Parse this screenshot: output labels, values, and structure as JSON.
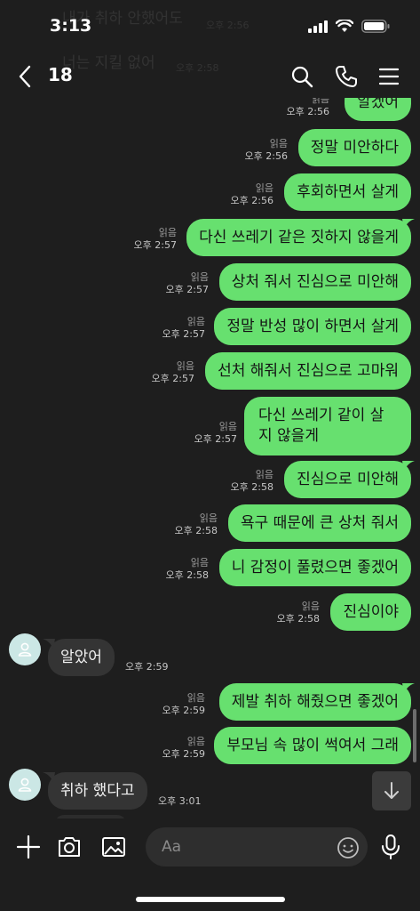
{
  "status_bar": {
    "time": "3:13"
  },
  "background_ghost": {
    "line1": "내가 취하 안했어도",
    "line1_time": "오후 2:56",
    "line2": "너는 지킬 없어",
    "line2_time": "오후 2:58"
  },
  "header": {
    "title": "18"
  },
  "labels": {
    "read": "읽음"
  },
  "messages": [
    {
      "dir": "sent",
      "text": "알겠어",
      "time": "오후 2:56"
    },
    {
      "dir": "sent",
      "text": "정말 미안하다",
      "time": "오후 2:56"
    },
    {
      "dir": "sent",
      "text": "후회하면서 살게",
      "time": "오후 2:56"
    },
    {
      "dir": "sent",
      "text": "다신 쓰레기 같은 짓하지 않을게",
      "time": "오후 2:57"
    },
    {
      "dir": "sent",
      "text": "상처 줘서 진심으로 미안해",
      "time": "오후 2:57"
    },
    {
      "dir": "sent",
      "text": "정말 반성 많이 하면서 살게",
      "time": "오후 2:57"
    },
    {
      "dir": "sent",
      "text": "선처 해줘서 진심으로 고마워",
      "time": "오후 2:57"
    },
    {
      "dir": "sent",
      "text": "다신 쓰레기 같이 살지 않을게",
      "time": "오후 2:57"
    },
    {
      "dir": "sent",
      "text": "진심으로 미안해",
      "time": "오후 2:58"
    },
    {
      "dir": "sent",
      "text": "욕구 때문에 큰 상처 줘서",
      "time": "오후 2:58"
    },
    {
      "dir": "sent",
      "text": "니 감정이 풀렸으면 좋겠어",
      "time": "오후 2:58"
    },
    {
      "dir": "sent",
      "text": "진심이야",
      "time": "오후 2:58"
    },
    {
      "dir": "received",
      "text": "알았어",
      "time": "오후 2:59"
    },
    {
      "dir": "sent",
      "text": "제발 취하 해줬으면 좋겠어",
      "time": "오후 2:59"
    },
    {
      "dir": "sent",
      "text": "부모님 속 많이 썩여서 그래",
      "time": "오후 2:59"
    },
    {
      "dir": "received",
      "text": "취하 했다고",
      "time": "오후 3:01"
    }
  ],
  "input": {
    "placeholder": "Aa",
    "value": ""
  },
  "colors": {
    "sent_bubble": "#67e06f",
    "received_bubble": "#343434",
    "background": "#1e1e1e"
  },
  "icons": [
    "back-icon",
    "search-icon",
    "phone-icon",
    "menu-icon",
    "plus-icon",
    "camera-icon",
    "image-icon",
    "emoji-icon",
    "microphone-icon",
    "arrow-down-icon",
    "person-icon"
  ]
}
